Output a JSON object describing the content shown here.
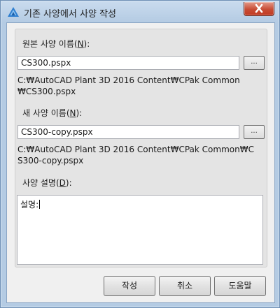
{
  "window": {
    "title": "기존 사양에서 사양 작성"
  },
  "source": {
    "label_prefix": "원본 사양 이름(",
    "label_mnemonic": "N",
    "label_suffix": "):",
    "value": "CS300.pspx",
    "browse_label": "...",
    "path": "C:₩AutoCAD Plant 3D 2016 Content₩CPak Common ₩CS300.pspx"
  },
  "target": {
    "label_prefix": "새 사양 이름(",
    "label_mnemonic": "N",
    "label_suffix": "):",
    "value": "CS300-copy.pspx",
    "browse_label": "...",
    "path": "C:₩AutoCAD Plant 3D 2016 Content₩CPak Common₩CS300-copy.pspx"
  },
  "description": {
    "label_prefix": "사양 설명(",
    "label_mnemonic": "D",
    "label_suffix": "):",
    "value": "설명:"
  },
  "buttons": {
    "create": "작성",
    "cancel": "취소",
    "help": "도움말"
  },
  "icons": {
    "app": "autocad-plant-icon",
    "close": "close-icon"
  }
}
